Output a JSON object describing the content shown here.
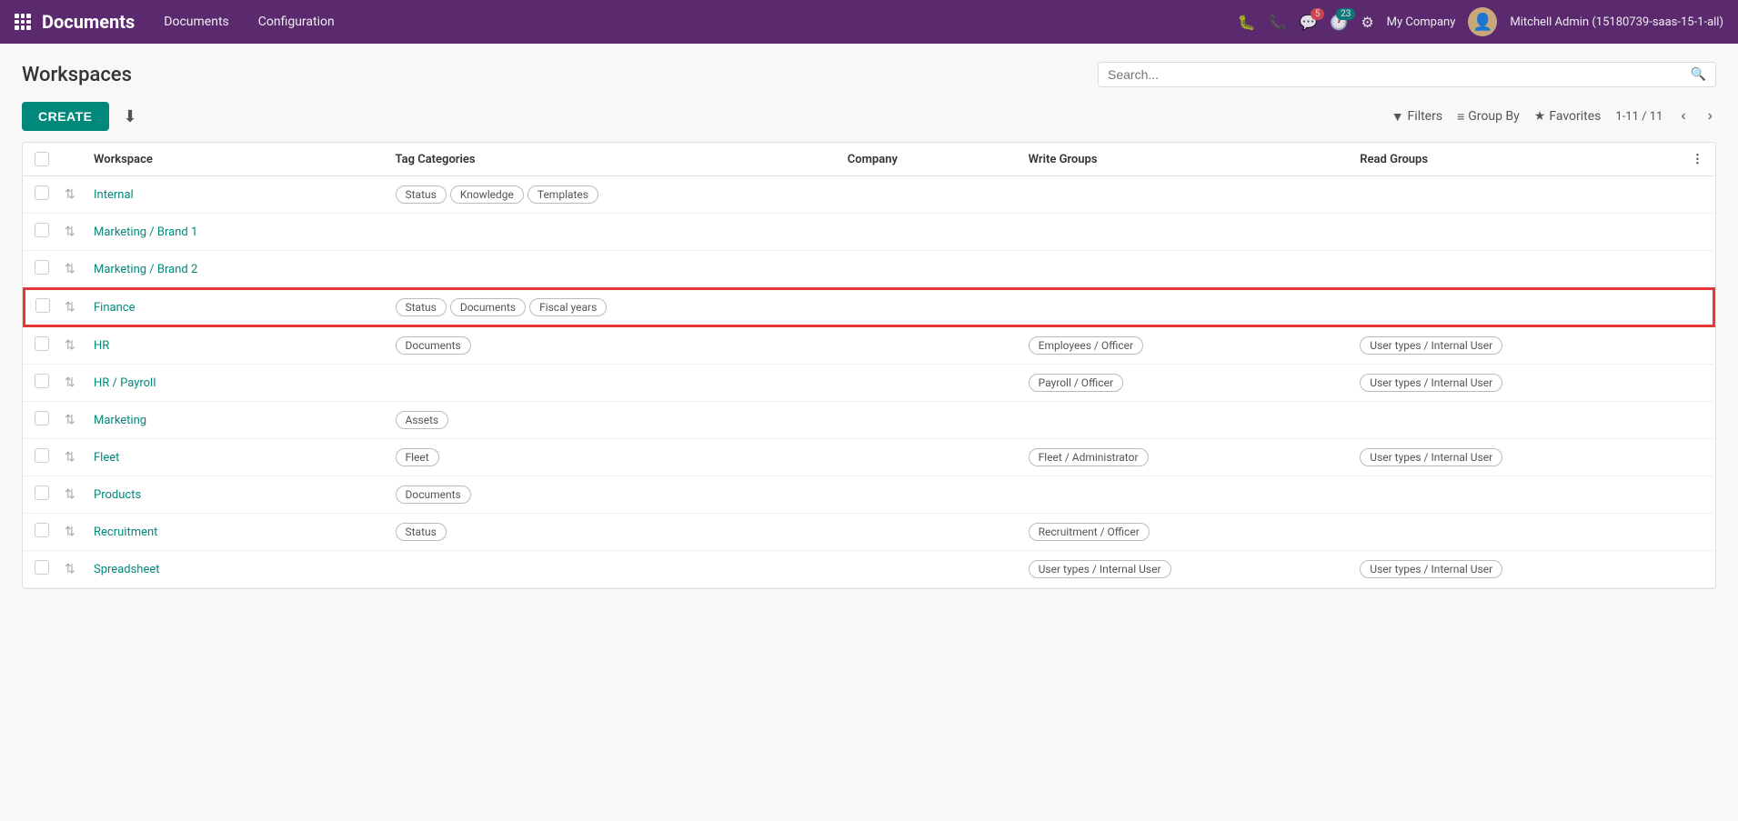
{
  "nav": {
    "app_name": "Documents",
    "menu_items": [
      "Documents",
      "Configuration"
    ],
    "company": "My Company",
    "username": "Mitchell Admin (15180739-saas-15-1-all)",
    "notification_count": 5,
    "activity_count": 23
  },
  "page": {
    "title": "Workspaces",
    "search_placeholder": "Search...",
    "pagination": "1-11 / 11"
  },
  "toolbar": {
    "create_label": "CREATE",
    "filters_label": "Filters",
    "groupby_label": "Group By",
    "favorites_label": "Favorites"
  },
  "table": {
    "columns": [
      "Workspace",
      "Tag Categories",
      "Company",
      "Write Groups",
      "Read Groups"
    ],
    "rows": [
      {
        "id": "internal",
        "workspace": "Internal",
        "tags": [
          "Status",
          "Knowledge",
          "Templates"
        ],
        "company": "",
        "write_groups": [],
        "read_groups": [],
        "highlighted": false
      },
      {
        "id": "marketing-brand1",
        "workspace": "Marketing / Brand 1",
        "tags": [],
        "company": "",
        "write_groups": [],
        "read_groups": [],
        "highlighted": false
      },
      {
        "id": "marketing-brand2",
        "workspace": "Marketing / Brand 2",
        "tags": [],
        "company": "",
        "write_groups": [],
        "read_groups": [],
        "highlighted": false
      },
      {
        "id": "finance",
        "workspace": "Finance",
        "tags": [
          "Status",
          "Documents",
          "Fiscal years"
        ],
        "company": "",
        "write_groups": [],
        "read_groups": [],
        "highlighted": true
      },
      {
        "id": "hr",
        "workspace": "HR",
        "tags": [
          "Documents"
        ],
        "company": "",
        "write_groups": [
          "Employees / Officer"
        ],
        "read_groups": [
          "User types / Internal User"
        ],
        "highlighted": false
      },
      {
        "id": "hr-payroll",
        "workspace": "HR / Payroll",
        "tags": [],
        "company": "",
        "write_groups": [
          "Payroll / Officer"
        ],
        "read_groups": [
          "User types / Internal User"
        ],
        "highlighted": false
      },
      {
        "id": "marketing",
        "workspace": "Marketing",
        "tags": [
          "Assets"
        ],
        "company": "",
        "write_groups": [],
        "read_groups": [],
        "highlighted": false
      },
      {
        "id": "fleet",
        "workspace": "Fleet",
        "tags": [
          "Fleet"
        ],
        "company": "",
        "write_groups": [
          "Fleet / Administrator"
        ],
        "read_groups": [
          "User types / Internal User"
        ],
        "highlighted": false
      },
      {
        "id": "products",
        "workspace": "Products",
        "tags": [
          "Documents"
        ],
        "company": "",
        "write_groups": [],
        "read_groups": [],
        "highlighted": false
      },
      {
        "id": "recruitment",
        "workspace": "Recruitment",
        "tags": [
          "Status"
        ],
        "company": "",
        "write_groups": [
          "Recruitment / Officer"
        ],
        "read_groups": [],
        "highlighted": false
      },
      {
        "id": "spreadsheet",
        "workspace": "Spreadsheet",
        "tags": [],
        "company": "",
        "write_groups": [
          "User types / Internal User"
        ],
        "read_groups": [
          "User types / Internal User"
        ],
        "highlighted": false
      }
    ]
  }
}
